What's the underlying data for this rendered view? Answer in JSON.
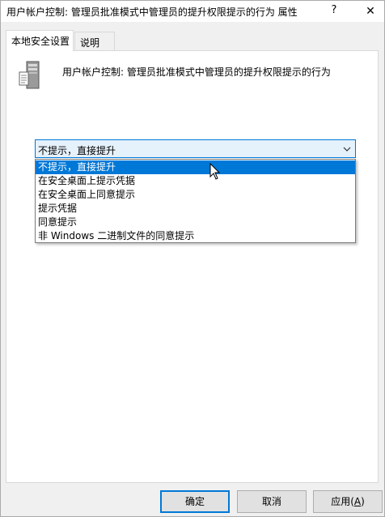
{
  "window": {
    "title": "用户帐户控制: 管理员批准模式中管理员的提升权限提示的行为 属性",
    "help_label": "?",
    "close_label": "✕"
  },
  "tabs": [
    {
      "label": "本地安全设置",
      "active": true
    },
    {
      "label": "说明",
      "active": false
    }
  ],
  "policy": {
    "icon": "server-policy-icon",
    "title": "用户帐户控制: 管理员批准模式中管理员的提升权限提示的行为"
  },
  "combo": {
    "selected": "不提示，直接提升",
    "arrow_icon": "chevron-down-icon",
    "options": [
      "不提示，直接提升",
      "在安全桌面上提示凭据",
      "在安全桌面上同意提示",
      "提示凭据",
      "同意提示",
      "非 Windows 二进制文件的同意提示"
    ]
  },
  "buttons": {
    "ok": "确定",
    "cancel": "取消",
    "apply_prefix": "应用(",
    "apply_key": "A",
    "apply_suffix": ")"
  },
  "colors": {
    "accent": "#0078d7",
    "combo_bg": "#e5f1fb",
    "window_bg": "#f0f0f0"
  }
}
